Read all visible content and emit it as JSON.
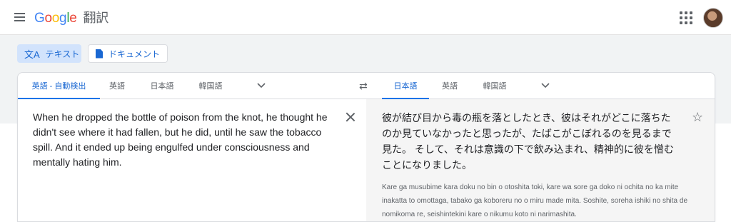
{
  "header": {
    "logo": [
      "G",
      "o",
      "o",
      "g",
      "l",
      "e"
    ],
    "product": "翻訳",
    "icons": {
      "menu": "hamburger-menu-icon",
      "apps": "apps-grid-icon",
      "avatar": "user-avatar"
    }
  },
  "modes": {
    "text_label": "テキスト",
    "doc_label": "ドキュメント"
  },
  "source_tabs": [
    "英語 - 自動検出",
    "英語",
    "日本語",
    "韓国語"
  ],
  "target_tabs": [
    "日本語",
    "英語",
    "韓国語"
  ],
  "source": {
    "text": "When he dropped the bottle of poison from the knot, he thought he didn't see where it had fallen, but he did, until he saw the tobacco spill. And it ended up being engulfed under consciousness and mentally hating him."
  },
  "target": {
    "text": "彼が結び目から毒の瓶を落としたとき、彼はそれがどこに落ちたのか見ていなかったと思ったが、たばこがこぼれるのを見るまで見た。 そして、それは意識の下で飲み込まれ、精神的に彼を憎むことになりました。",
    "romanization": "Kare ga musubime kara doku no bin o otoshita toki, kare wa sore ga doko ni ochita no ka mite inakatta to omottaga, tabako ga koboreru no o miru made mita. Soshite, soreha ishiki no shita de nomikoma re, seishintekini kare o nikumu koto ni narimashita."
  },
  "colors": {
    "accent": "#1a73e8",
    "active_tab": "#1967d2",
    "mode_bg": "#d2e3fc",
    "target_bg": "#f5f5f5"
  }
}
